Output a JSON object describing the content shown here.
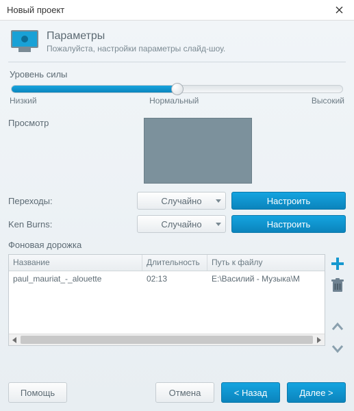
{
  "window": {
    "title": "Новый проект"
  },
  "header": {
    "title": "Параметры",
    "subtitle": "Пожалуйста, настройки параметры слайд-шоу."
  },
  "slider": {
    "label": "Уровень силы",
    "low": "Низкий",
    "mid": "Нормальный",
    "high": "Высокий",
    "value_pct": 50
  },
  "preview": {
    "label": "Просмотр"
  },
  "transitions": {
    "label": "Переходы:",
    "value": "Случайно",
    "configure": "Настроить"
  },
  "kenburns": {
    "label": "Ken Burns:",
    "value": "Случайно",
    "configure": "Настроить"
  },
  "track": {
    "label": "Фоновая дорожка",
    "columns": {
      "name": "Название",
      "duration": "Длительность",
      "path": "Путь к файлу"
    },
    "rows": [
      {
        "name": "paul_mauriat_-_alouette",
        "duration": "02:13",
        "path": "E:\\Василий - Музыка\\M"
      }
    ]
  },
  "footer": {
    "help": "Помощь",
    "cancel": "Отмена",
    "back": "<  Назад",
    "next": "Далее  >"
  }
}
